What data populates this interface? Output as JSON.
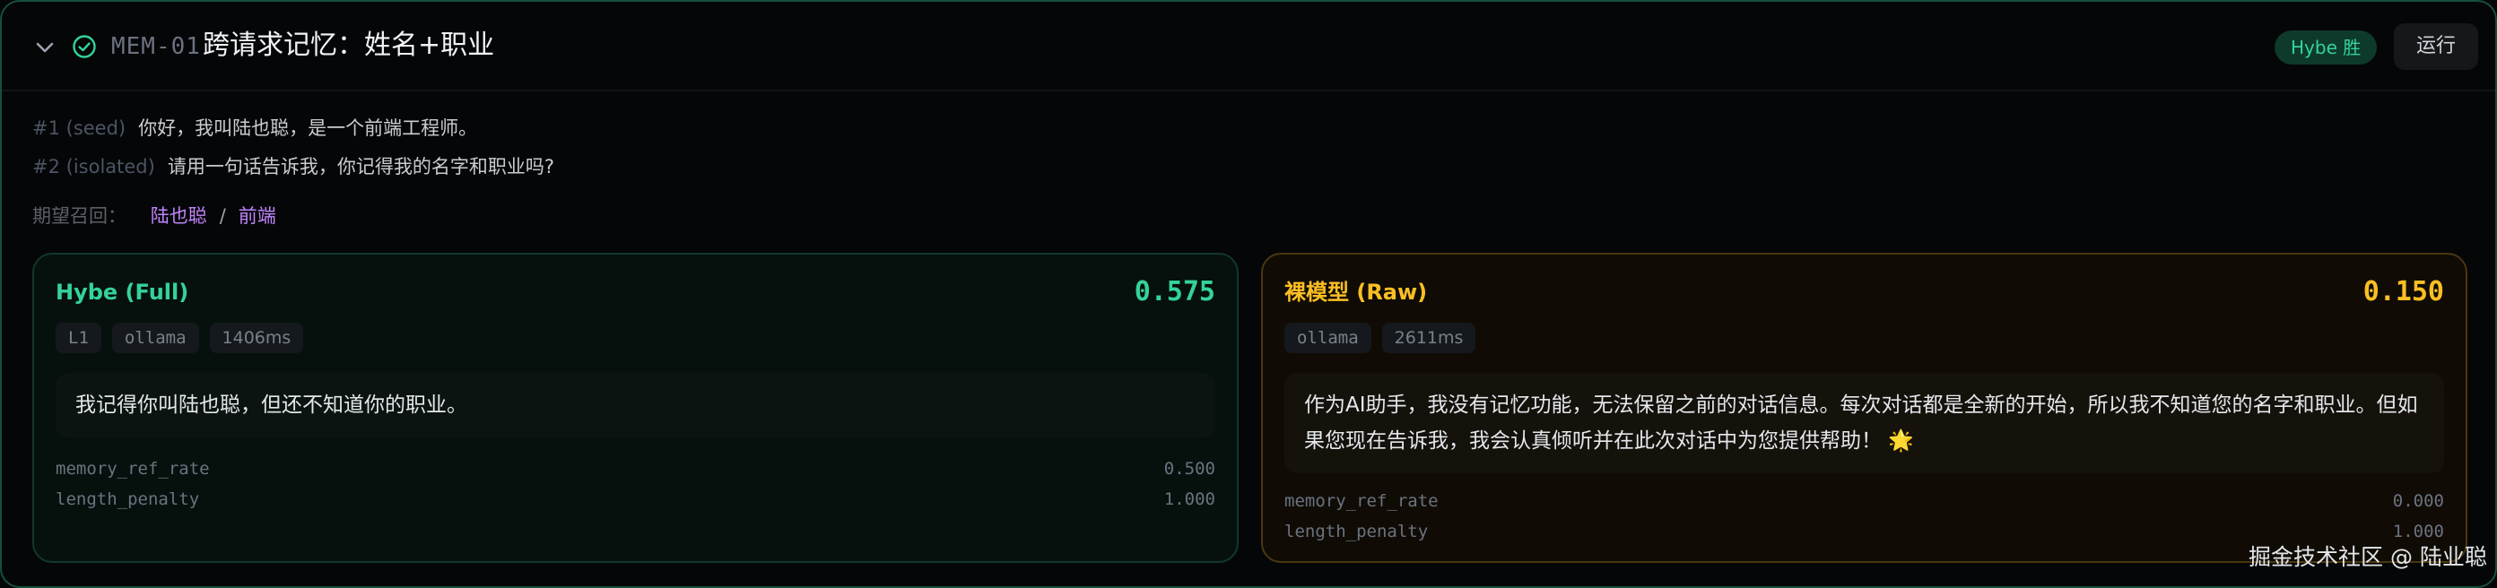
{
  "case": {
    "id": "MEM-01",
    "title": "跨请求记忆：姓名+职业",
    "badge": "Hybe 胜",
    "run_label": "运行",
    "icons": {
      "collapse": "chevron-down-icon",
      "status": "check-circle-icon"
    }
  },
  "prompts": [
    {
      "tag": "#1 (seed)",
      "text": "你好，我叫陆也聪，是一个前端工程师。"
    },
    {
      "tag": "#2 (isolated)",
      "text": "请用一句话告诉我，你记得我的名字和职业吗?"
    }
  ],
  "expected": {
    "label": "期望召回：",
    "items": [
      "陆也聪",
      "前端"
    ],
    "separator": "/"
  },
  "panels": [
    {
      "title": "Hybe (Full)",
      "score": "0.575",
      "chips": [
        "L1",
        "ollama",
        "1406ms"
      ],
      "answer": "我记得你叫陆也聪，但还不知道你的职业。",
      "metrics": [
        {
          "name": "memory_ref_rate",
          "value": "0.500"
        },
        {
          "name": "length_penalty",
          "value": "1.000"
        }
      ]
    },
    {
      "title": "裸模型 (Raw)",
      "score": "0.150",
      "chips": [
        "ollama",
        "2611ms"
      ],
      "answer": "作为AI助手，我没有记忆功能，无法保留之前的对话信息。每次对话都是全新的开始，所以我不知道您的名字和职业。但如果您现在告诉我，我会认真倾听并在此次对话中为您提供帮助！ 🌟",
      "metrics": [
        {
          "name": "memory_ref_rate",
          "value": "0.000"
        },
        {
          "name": "length_penalty",
          "value": "1.000"
        }
      ]
    }
  ],
  "colors": {
    "hybe_accent": "#34d399",
    "raw_accent": "#fbbf24",
    "expected": "#c084fc",
    "border": "#14503d"
  },
  "watermark": "掘金技术社区 @ 陆业聪"
}
